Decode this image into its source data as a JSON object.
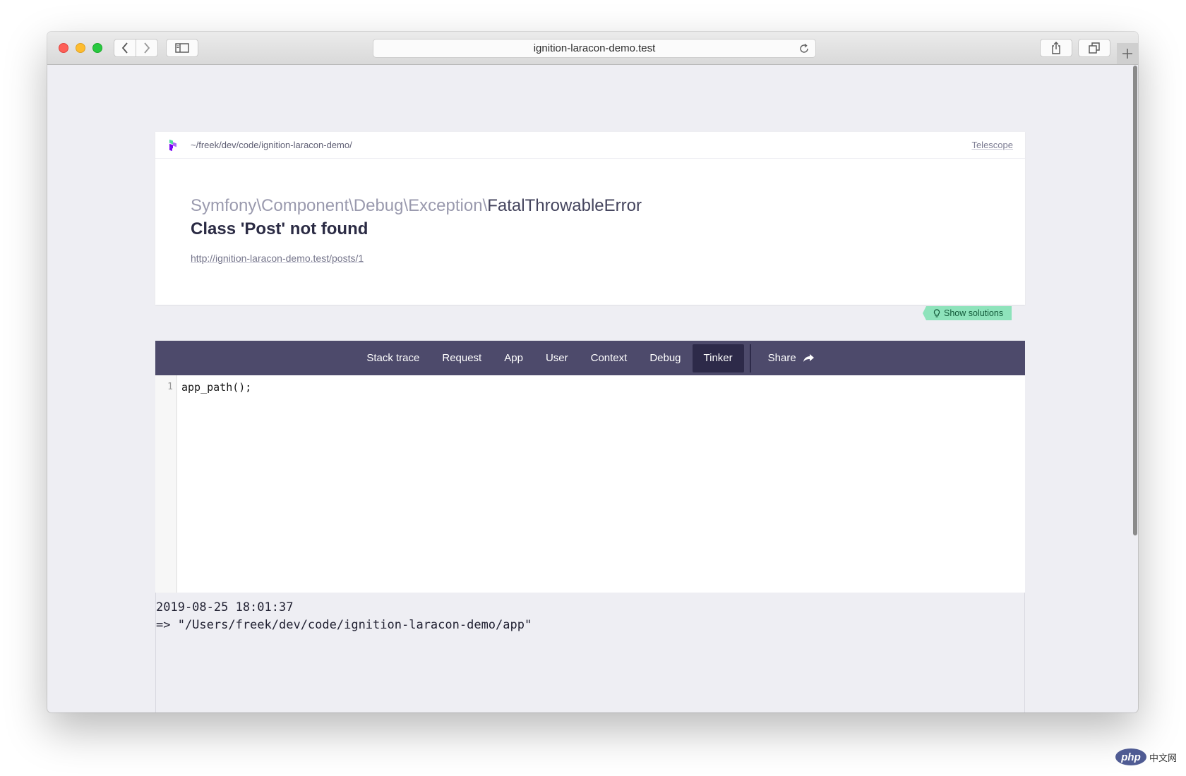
{
  "browser": {
    "url": "ignition-laracon-demo.test"
  },
  "header": {
    "app_path": "~/freek/dev/code/ignition-laracon-demo/",
    "telescope_label": "Telescope"
  },
  "exception": {
    "class_prefix": "Symfony\\Component\\Debug\\Exception\\",
    "class_name": "FatalThrowableError",
    "message": "Class 'Post' not found",
    "request_url": "http://ignition-laracon-demo.test/posts/1"
  },
  "solutions_button": {
    "label": "Show solutions"
  },
  "tabs": [
    {
      "label": "Stack trace",
      "active": false
    },
    {
      "label": "Request",
      "active": false
    },
    {
      "label": "App",
      "active": false
    },
    {
      "label": "User",
      "active": false
    },
    {
      "label": "Context",
      "active": false
    },
    {
      "label": "Debug",
      "active": false
    },
    {
      "label": "Tinker",
      "active": true
    }
  ],
  "share_tab": {
    "label": "Share"
  },
  "editor": {
    "line_number": "1",
    "code": "app_path();"
  },
  "output": {
    "timestamp": "2019-08-25 18:01:37",
    "result": "=> \"/Users/freek/dev/code/ignition-laracon-demo/app\""
  },
  "watermark": {
    "badge": "php",
    "text": "中文网"
  },
  "colors": {
    "tab_bar": "#4d4a6b",
    "tab_active": "#2d2a49",
    "solutions": "#8ee3bb"
  }
}
